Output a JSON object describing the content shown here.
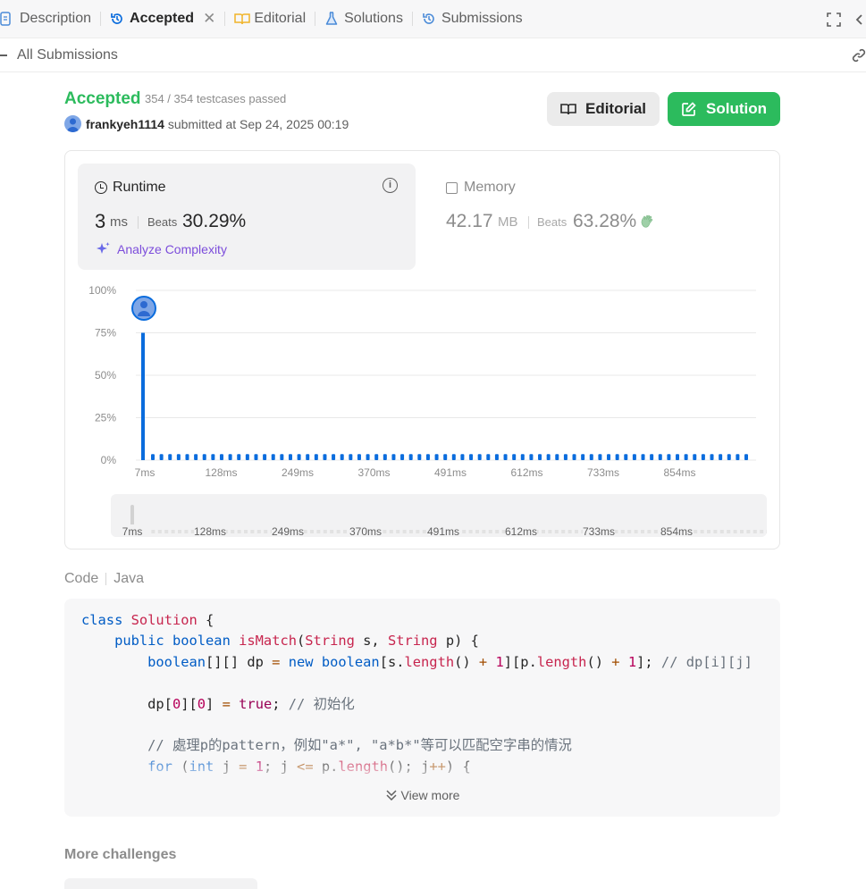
{
  "tabs": [
    {
      "label": "Description",
      "icon": "description-icon"
    },
    {
      "label": "Accepted",
      "icon": "history-icon",
      "active": true
    },
    {
      "label": "Editorial",
      "icon": "book-icon"
    },
    {
      "label": "Solutions",
      "icon": "flask-icon"
    },
    {
      "label": "Submissions",
      "icon": "history-icon"
    }
  ],
  "subbar": {
    "label": "All Submissions"
  },
  "result": {
    "status": "Accepted",
    "testcases": "354 / 354 testcases passed",
    "username": "frankyeh1114",
    "submitted_text": "submitted at Sep 24, 2025 00:19"
  },
  "buttons": {
    "editorial": "Editorial",
    "solution": "Solution"
  },
  "runtime": {
    "title": "Runtime",
    "value": "3",
    "unit": "ms",
    "beats_label": "Beats",
    "beats": "30.29%",
    "analyze": "Analyze Complexity"
  },
  "memory": {
    "title": "Memory",
    "value": "42.17",
    "unit": "MB",
    "beats_label": "Beats",
    "beats": "63.28%"
  },
  "colors": {
    "accepted": "#2cbb5d",
    "bar": "#0a6cdd",
    "analyze": "#7c4ddb"
  },
  "chart_data": {
    "type": "bar",
    "title": "",
    "xlabel": "",
    "ylabel": "",
    "ylim": [
      0,
      100
    ],
    "yticks": [
      "100%",
      "75%",
      "50%",
      "25%",
      "0%"
    ],
    "xticks": [
      "7ms",
      "128ms",
      "249ms",
      "370ms",
      "491ms",
      "612ms",
      "733ms",
      "854ms"
    ],
    "highlight_bar": {
      "x": "3ms",
      "value": 75
    },
    "small_bar_value": 2,
    "small_bar_count": 70,
    "grid": true
  },
  "overview": {
    "xticks": [
      "7ms",
      "128ms",
      "249ms",
      "370ms",
      "491ms",
      "612ms",
      "733ms",
      "854ms"
    ]
  },
  "code": {
    "label": "Code",
    "language": "Java",
    "view_more": "View more"
  },
  "more": {
    "title": "More challenges"
  }
}
